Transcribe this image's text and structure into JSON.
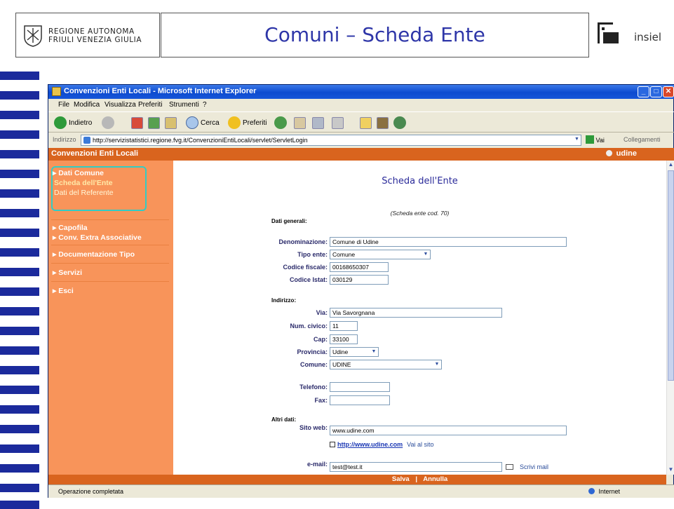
{
  "slide": {
    "region_line1": "REGIONE AUTONOMA",
    "region_line2": "FRIULI VENEZIA GIULIA",
    "title": "Comuni – Scheda Ente",
    "insiel": "insiel"
  },
  "browser": {
    "title": "Convenzioni Enti Locali - Microsoft Internet Explorer",
    "menu": [
      "File",
      "Modifica",
      "Visualizza",
      "Preferiti",
      "Strumenti",
      "?"
    ],
    "toolbar": {
      "back": "Indietro",
      "search": "Cerca",
      "favorites": "Preferiti"
    },
    "address_label": "Indirizzo",
    "address": "http://servizistatistici.regione.fvg.it/ConvenzioniEntiLocali/servlet/ServletLogin",
    "go": "Vai",
    "links": "Collegamenti",
    "status": "Operazione completata",
    "zone": "Internet"
  },
  "app": {
    "header": "Convenzioni Enti Locali",
    "user": "udine",
    "sidebar": {
      "dati_comune": "Dati Comune",
      "scheda_ente": "Scheda dell'Ente",
      "dati_referente": "Dati del Referente",
      "capofila": "Capofila",
      "conv_extra": "Conv. Extra Associative",
      "documentazione": "Documentazione Tipo",
      "servizi": "Servizi",
      "esci": "Esci"
    },
    "page_title": "Scheda dell'Ente",
    "cod": "(Scheda ente cod. 70)",
    "sections": {
      "generali": "Dati generali:",
      "indirizzo": "Indirizzo:",
      "altri": "Altri dati:"
    },
    "labels": {
      "denominazione": "Denominazione:",
      "tipo_ente": "Tipo ente:",
      "codice_fiscale": "Codice fiscale:",
      "codice_istat": "Codice Istat:",
      "via": "Via:",
      "num_civico": "Num. civico:",
      "cap": "Cap:",
      "provincia": "Provincia:",
      "comune": "Comune:",
      "telefono": "Telefono:",
      "fax": "Fax:",
      "sito_web": "Sito web:",
      "email": "e-mail:"
    },
    "values": {
      "denominazione": "Comune di Udine",
      "tipo_ente": "Comune",
      "codice_fiscale": "00168650307",
      "codice_istat": "030129",
      "via": "Via Savorgnana",
      "num_civico": "11",
      "cap": "33100",
      "provincia": "Udine",
      "comune": "UDINE",
      "telefono": "",
      "fax": "",
      "sito_web": "www.udine.com",
      "email": "test@test.it"
    },
    "site_link": "http://www.udine.com",
    "site_go": "Vai al sito",
    "mail_action": "Scrivi mail",
    "bottom": {
      "save": "Salva",
      "sep": "|",
      "cancel": "Annulla"
    }
  }
}
